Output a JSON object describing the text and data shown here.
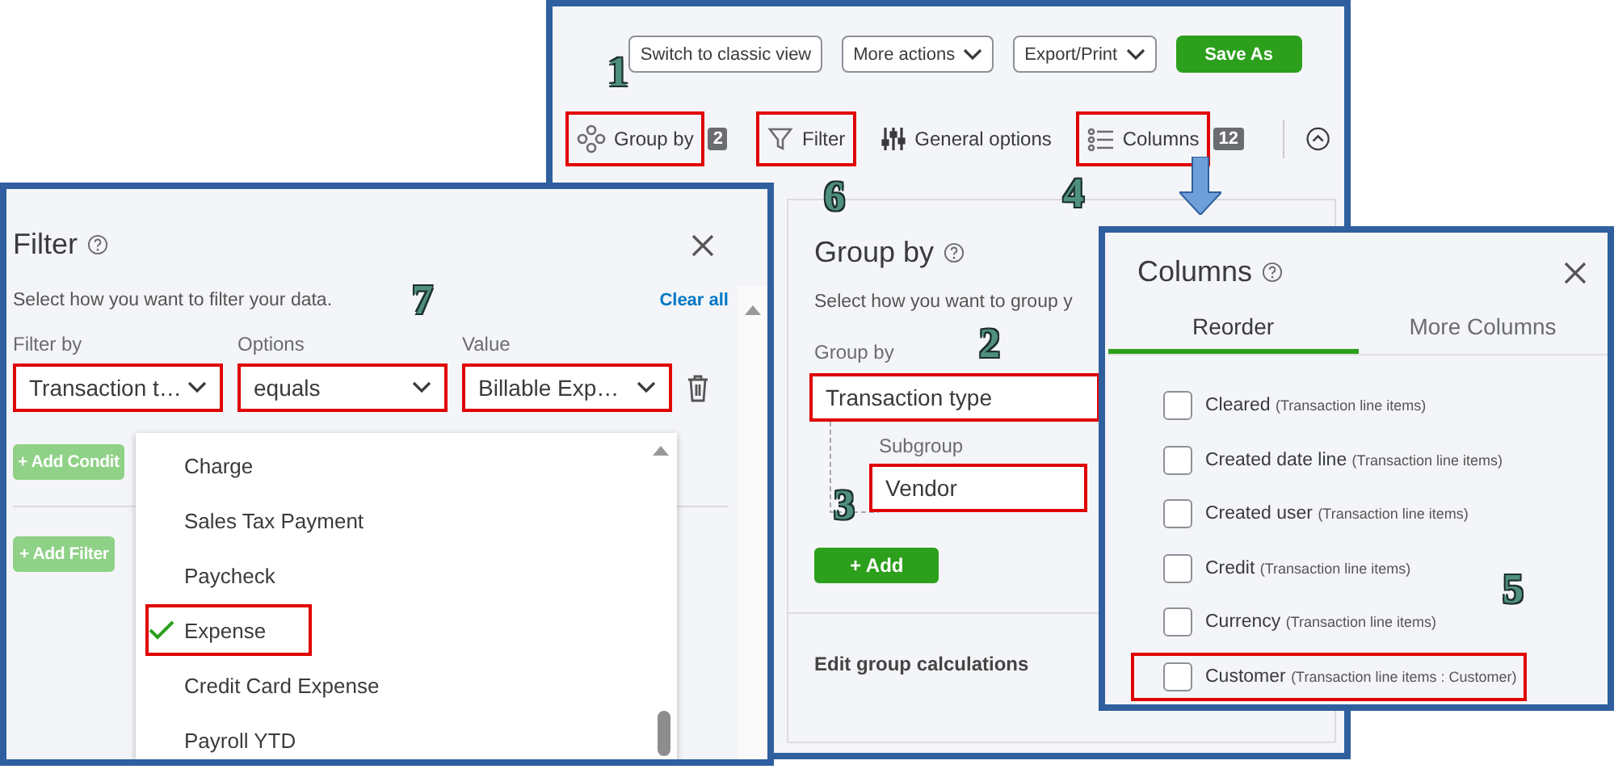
{
  "main_panel": {
    "top_buttons": [
      {
        "label": "Switch to classic view",
        "kind": "outline",
        "caret": false
      },
      {
        "label": "More actions",
        "kind": "outline",
        "caret": true
      },
      {
        "label": "Export/Print",
        "kind": "outline",
        "caret": true
      },
      {
        "label": "Save As",
        "kind": "primary",
        "caret": false
      }
    ],
    "toolbar": [
      {
        "label": "Group by",
        "badge": "2",
        "highlighted": true
      },
      {
        "label": "Filter",
        "highlighted": true
      },
      {
        "label": "General options",
        "highlighted": false
      },
      {
        "label": "Columns",
        "badge": "12",
        "highlighted": true
      }
    ],
    "group_panel": {
      "title": "Group by",
      "description": "Select how you want to group y",
      "group_label": "Group by",
      "group_value": "Transaction type",
      "group_highlighted": true,
      "subgroup_label": "Subgroup",
      "subgroup_value": "Vendor",
      "subgroup_highlighted": true,
      "add_button": "+ Add",
      "footer": "Edit group calculations"
    }
  },
  "filter_panel": {
    "title": "Filter",
    "description": "Select how you want to filter your data.",
    "clear_link": "Clear all",
    "fields": [
      {
        "label": "Filter by",
        "value": "Transaction t…",
        "highlighted": true
      },
      {
        "label": "Options",
        "value": "equals",
        "highlighted": true
      },
      {
        "label": "Value",
        "value": "Billable Exp…",
        "highlighted": true
      }
    ],
    "add_condition": "+ Add Condit",
    "add_filter": "+ Add Filter",
    "options": [
      {
        "label": "Charge",
        "selected": false,
        "highlighted": false
      },
      {
        "label": "Sales Tax Payment",
        "selected": false,
        "highlighted": false
      },
      {
        "label": "Paycheck",
        "selected": false,
        "highlighted": false
      },
      {
        "label": "Expense",
        "selected": true,
        "highlighted": true
      },
      {
        "label": "Credit Card Expense",
        "selected": false,
        "highlighted": false
      },
      {
        "label": "Payroll YTD",
        "selected": false,
        "highlighted": false
      }
    ]
  },
  "columns_panel": {
    "title": "Columns",
    "tabs": [
      {
        "label": "Reorder",
        "selected": true
      },
      {
        "label": "More Columns",
        "selected": false
      }
    ],
    "items": [
      {
        "name": "Cleared",
        "detail": "(Transaction line items)",
        "checked": false,
        "highlighted": false
      },
      {
        "name": "Created date line",
        "detail": "(Transaction line items)",
        "checked": false,
        "highlighted": false
      },
      {
        "name": "Created user",
        "detail": "(Transaction line items)",
        "checked": false,
        "highlighted": false
      },
      {
        "name": "Credit",
        "detail": "(Transaction line items)",
        "checked": false,
        "highlighted": false
      },
      {
        "name": "Currency",
        "detail": "(Transaction line items)",
        "checked": false,
        "highlighted": false
      },
      {
        "name": "Customer",
        "detail": "(Transaction line items : Customer)",
        "checked": false,
        "highlighted": true
      }
    ]
  },
  "callouts": [
    "1",
    "6",
    "4",
    "2",
    "3",
    "7",
    "5"
  ]
}
